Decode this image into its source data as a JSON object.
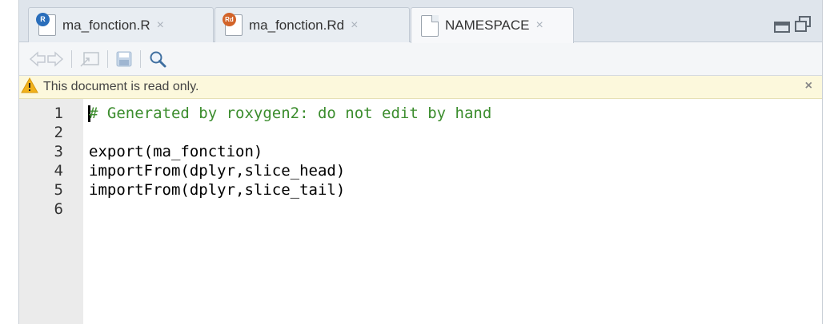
{
  "tabs": [
    {
      "label": "ma_fonction.R",
      "icon": "r-file-icon",
      "badge": "R",
      "badge_color": "#2a6ebb",
      "close": "×"
    },
    {
      "label": "ma_fonction.Rd",
      "icon": "rd-file-icon",
      "badge": "Rd",
      "badge_color": "#d2642a",
      "close": "×"
    },
    {
      "label": "NAMESPACE",
      "icon": "plain-file-icon",
      "close": "×",
      "active": true
    }
  ],
  "toolbar": {
    "buttons": [
      "back-arrow-icon",
      "forward-arrow-icon",
      "show-in-new-window-icon",
      "save-icon",
      "find-icon"
    ]
  },
  "banner": {
    "text": "This document is read only.",
    "icon": "warning-icon",
    "close": "×"
  },
  "editor": {
    "lines": [
      {
        "num": "1",
        "text": "# Generated by roxygen2: do not edit by hand"
      },
      {
        "num": "2",
        "text": ""
      },
      {
        "num": "3",
        "text": "export(ma_fonction)"
      },
      {
        "num": "4",
        "text": "importFrom(dplyr,slice_head)"
      },
      {
        "num": "5",
        "text": "importFrom(dplyr,slice_tail)"
      },
      {
        "num": "6",
        "text": ""
      }
    ]
  },
  "colors": {
    "comment": "#3c8d2e",
    "tabstrip": "#dfe5ec",
    "banner": "#fcf8dc",
    "gutter": "#ebebeb"
  }
}
